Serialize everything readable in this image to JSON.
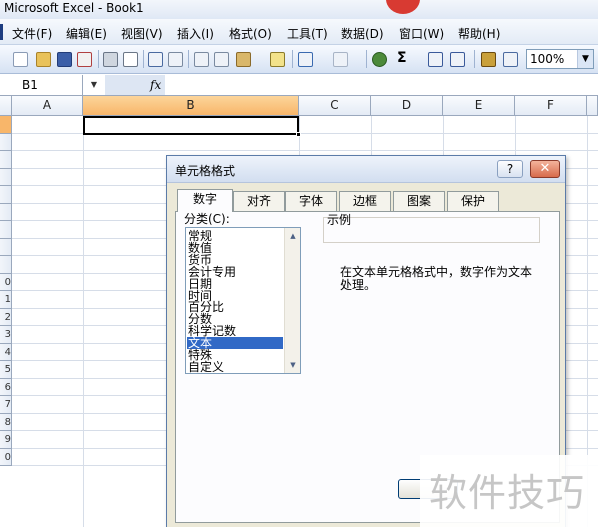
{
  "window": {
    "title": "Microsoft Excel - Book1"
  },
  "menu": [
    "文件(F)",
    "编辑(E)",
    "视图(V)",
    "插入(I)",
    "格式(O)",
    "工具(T)",
    "数据(D)",
    "窗口(W)",
    "帮助(H)"
  ],
  "toolbar": {
    "zoom": "100%",
    "autosum_glyph": "Σ",
    "icons": [
      "new-icon",
      "open-icon",
      "save-icon",
      "permission-icon",
      "print-icon",
      "print-preview-icon",
      "spelling-icon",
      "research-icon",
      "cut-icon",
      "copy-icon",
      "paste-icon",
      "format-painter-icon",
      "undo-icon",
      "redo-icon",
      "hyperlink-icon",
      "autosum-icon",
      "sort-ascending-icon",
      "sort-descending-icon",
      "chart-wizard-icon",
      "drawing-icon"
    ]
  },
  "formula_bar": {
    "name_box": "B1",
    "fx": "fx",
    "value": ""
  },
  "sheet": {
    "columns": [
      "A",
      "B",
      "C",
      "D",
      "E",
      "F"
    ],
    "selected_column": "B",
    "row_headers": [
      "",
      "",
      "",
      "",
      "",
      "",
      "",
      "",
      "",
      "0",
      "1",
      "2",
      "3",
      "4",
      "5",
      "6",
      "7",
      "8",
      "9",
      "0"
    ]
  },
  "dialog": {
    "title": "单元格格式",
    "help": "?",
    "close": "✕",
    "tabs": [
      "数字",
      "对齐",
      "字体",
      "边框",
      "图案",
      "保护"
    ],
    "active_tab": "数字",
    "category_label": "分类(C):",
    "categories": [
      "常规",
      "数值",
      "货币",
      "会计专用",
      "日期",
      "时间",
      "百分比",
      "分数",
      "科学记数",
      "文本",
      "特殊",
      "自定义"
    ],
    "selected_category": "文本",
    "sample_label": "示例",
    "description": "在文本单元格格式中，数字作为文本处理。"
  },
  "watermark": "软件技巧"
}
